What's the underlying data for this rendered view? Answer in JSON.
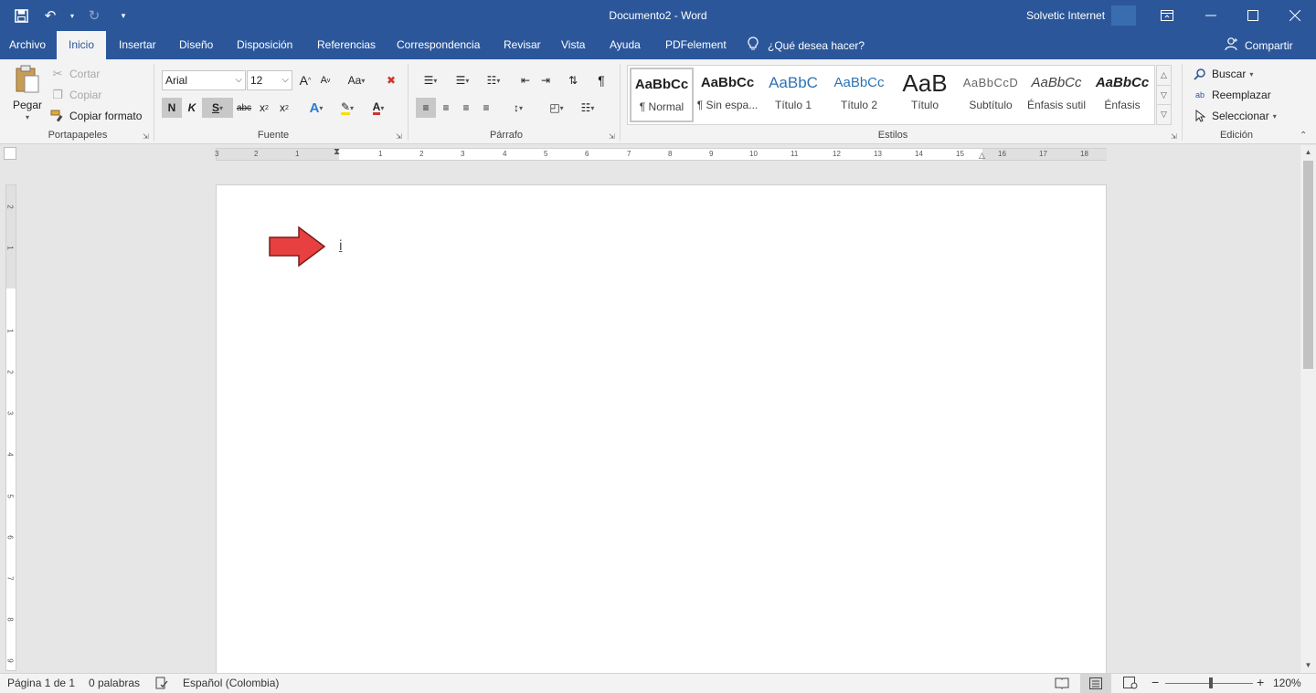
{
  "window": {
    "doc_title": "Documento2  -  Word",
    "user_name": "Solvetic Internet"
  },
  "tabs": [
    "Archivo",
    "Inicio",
    "Insertar",
    "Diseño",
    "Disposición",
    "Referencias",
    "Correspondencia",
    "Revisar",
    "Vista",
    "Ayuda",
    "PDFelement"
  ],
  "active_tab": "Inicio",
  "tell_me": "¿Qué desea hacer?",
  "share": "Compartir",
  "clipboard": {
    "paste": "Pegar",
    "cut": "Cortar",
    "copy": "Copiar",
    "format_painter": "Copiar formato",
    "label": "Portapapeles"
  },
  "font": {
    "name": "Arial",
    "size": "12",
    "grow": "A",
    "shrink": "A",
    "case": "Aa",
    "bold": "N",
    "italic": "K",
    "underline": "S",
    "strike": "abc",
    "subscript": "x",
    "superscript": "x",
    "label": "Fuente"
  },
  "paragraph": {
    "pilcrow": "¶",
    "label": "Párrafo"
  },
  "styles": {
    "label": "Estilos",
    "items": [
      {
        "sample": "AaBbCc",
        "name": "¶ Normal"
      },
      {
        "sample": "AaBbCc",
        "name": "¶ Sin espa..."
      },
      {
        "sample": "AaBbC",
        "name": "Título 1"
      },
      {
        "sample": "AaBbCc",
        "name": "Título 2"
      },
      {
        "sample": "AaB",
        "name": "Título"
      },
      {
        "sample": "AaBbCcD",
        "name": "Subtítulo"
      },
      {
        "sample": "AaBbCc",
        "name": "Énfasis sutil"
      },
      {
        "sample": "AaBbCc",
        "name": "Énfasis"
      }
    ]
  },
  "editing": {
    "find": "Buscar",
    "replace": "Reemplazar",
    "select": "Seleccionar",
    "label": "Edición"
  },
  "ruler": {
    "h_labels": [
      "3",
      "2",
      "1",
      "1",
      "2",
      "3",
      "4",
      "5",
      "6",
      "7",
      "8",
      "9",
      "10",
      "11",
      "12",
      "13",
      "14",
      "15",
      "16",
      "17",
      "18"
    ],
    "v_labels": [
      "2",
      "1",
      "1",
      "2",
      "3",
      "4",
      "5",
      "6",
      "7",
      "8",
      "9"
    ]
  },
  "document": {
    "cursor_char": "i"
  },
  "status": {
    "page": "Página 1 de 1",
    "words": "0 palabras",
    "language": "Español (Colombia)",
    "zoom": "120%"
  },
  "colors": {
    "brand": "#2b579a",
    "arrow": "#e84040"
  }
}
